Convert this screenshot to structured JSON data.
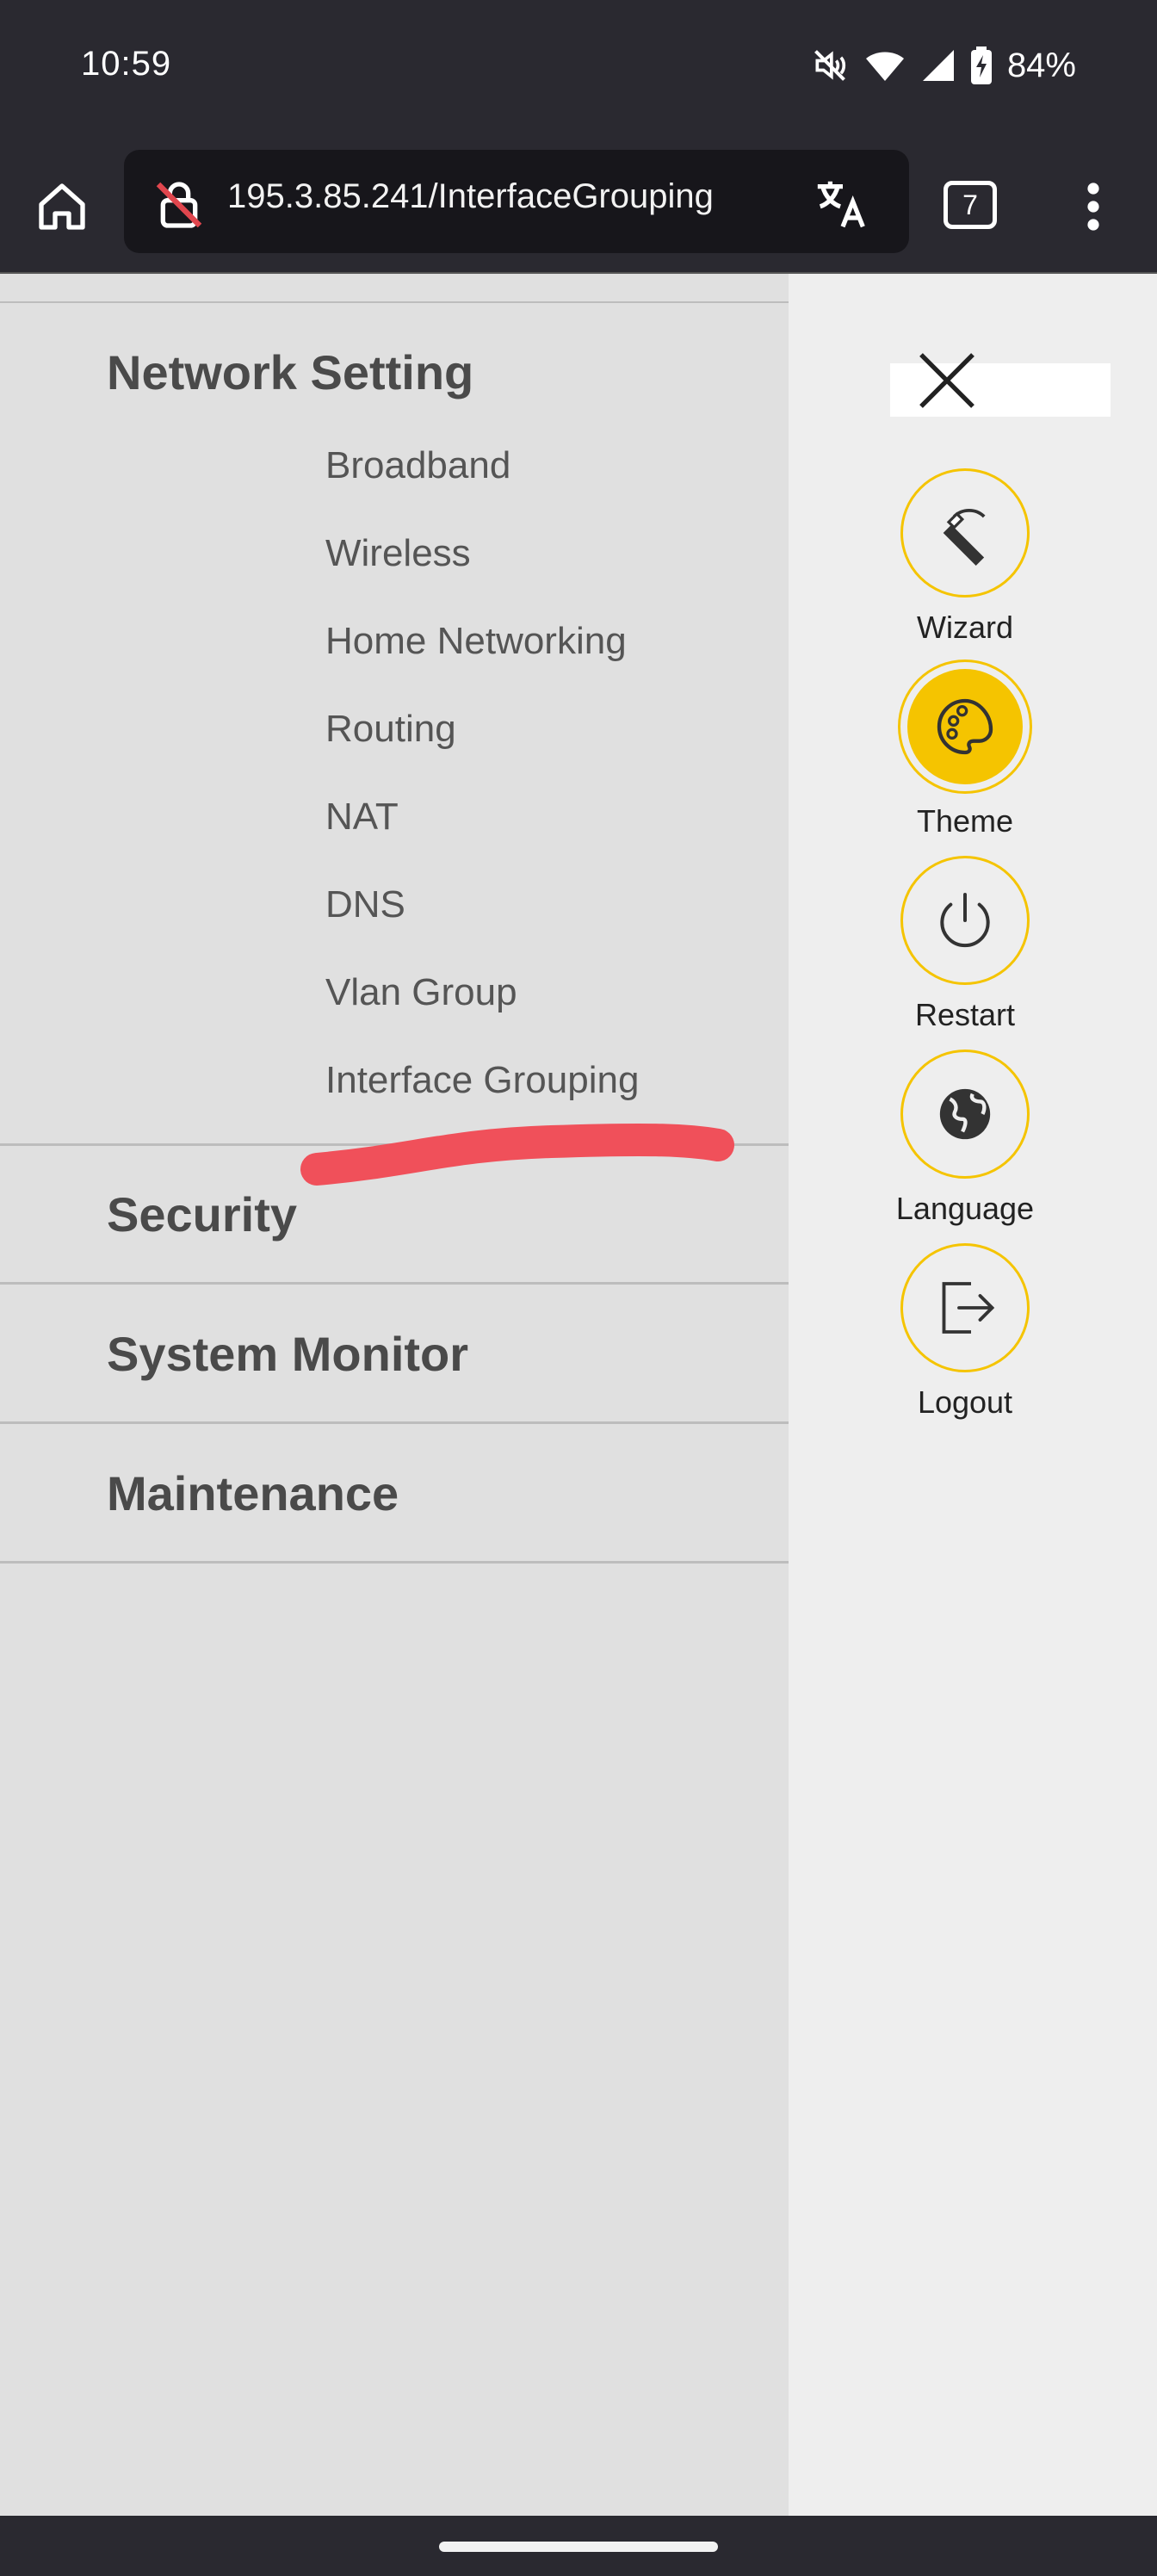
{
  "status_bar": {
    "time": "10:59",
    "battery_percent": "84%",
    "icons": [
      "mute-vibrate-icon",
      "wifi-icon",
      "cell-signal-icon",
      "battery-charging-icon"
    ]
  },
  "browser": {
    "url": "195.3.85.241/InterfaceGrouping",
    "tab_count": "7",
    "icons": [
      "home-icon",
      "insecure-lock-icon",
      "translate-icon",
      "more-vert-icon"
    ]
  },
  "menu": {
    "sections": [
      {
        "title": "Network Setting",
        "items": [
          "Broadband",
          "Wireless",
          "Home Networking",
          "Routing",
          "NAT",
          "DNS",
          "Vlan Group",
          "Interface Grouping"
        ]
      },
      {
        "title": "Security"
      },
      {
        "title": "System Monitor"
      },
      {
        "title": "Maintenance"
      }
    ]
  },
  "rail": {
    "close_icon": "close-icon",
    "items": [
      {
        "label": "Wizard",
        "icon": "wand-icon"
      },
      {
        "label": "Theme",
        "icon": "palette-icon",
        "active": true
      },
      {
        "label": "Restart",
        "icon": "power-icon"
      },
      {
        "label": "Language",
        "icon": "globe-icon"
      },
      {
        "label": "Logout",
        "icon": "logout-icon"
      }
    ]
  },
  "colors": {
    "accent": "#f5c400",
    "annotation": "#f0505a",
    "menu_background": "#e0e0e0",
    "rail_background": "#eeeeee",
    "chrome_dark": "#2a2930"
  }
}
